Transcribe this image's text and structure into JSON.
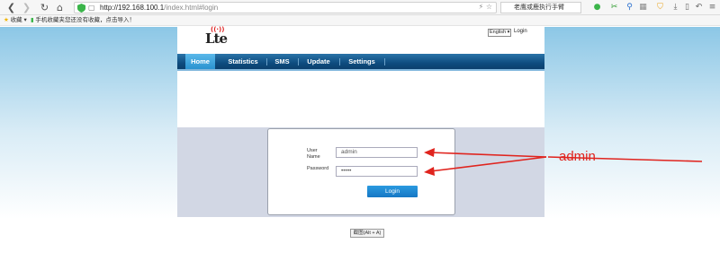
{
  "browser": {
    "url_host": "http://192.168.100.1",
    "url_path": "/index.html#login",
    "search_text": "老鹰或鹿执行手臂",
    "bookmarks": [
      {
        "label": "收藏",
        "icon": "star-icon"
      },
      {
        "label": "手机收藏夹",
        "icon": "phone-icon"
      },
      {
        "label": "您还没有收藏，点击导入！",
        "icon": ""
      }
    ]
  },
  "router": {
    "logo_text": "Lte",
    "language": "English",
    "top_login": "Login",
    "nav": [
      "Home",
      "Statistics",
      "SMS",
      "Update",
      "Settings"
    ],
    "active_nav": "Home",
    "login_form": {
      "username_label_line1": "User",
      "username_label_line2": "Name",
      "password_label": "Password",
      "username_value": "admin",
      "password_value": "•••••",
      "login_button": "Login"
    }
  },
  "screenshot_hint": "截图(Alt + A)",
  "annotation": "admin",
  "colors": {
    "nav_blue": "#0e4d80",
    "active_tab": "#2a93d0",
    "login_button": "#1677c4",
    "arrow_red": "#e0241e"
  }
}
